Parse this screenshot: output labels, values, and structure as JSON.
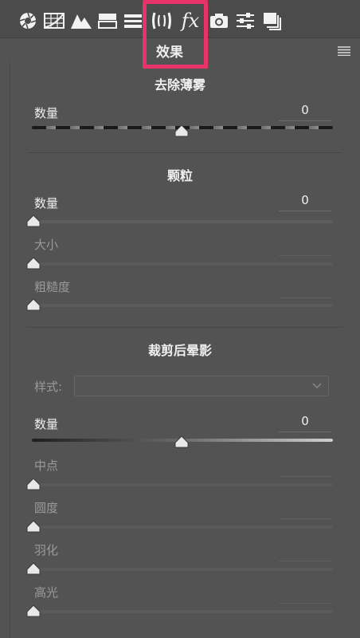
{
  "toolbar": {
    "icons": [
      "aperture-icon",
      "grid-curve-icon",
      "mountains-icon",
      "split-toning-icon",
      "lens-icon",
      "fx-icon",
      "camera-icon",
      "sliders-icon",
      "presets-icon"
    ],
    "active_tab_label": "效果",
    "fx_text": "fx"
  },
  "accent_color": "#e8336a",
  "dehaze": {
    "title": "去除薄雾",
    "amount_label": "数量",
    "amount_value": "0"
  },
  "grain": {
    "title": "颗粒",
    "amount_label": "数量",
    "amount_value": "0",
    "size_label": "大小",
    "roughness_label": "粗糙度"
  },
  "vignette": {
    "title": "裁剪后晕影",
    "style_label": "样式:",
    "amount_label": "数量",
    "amount_value": "0",
    "midpoint_label": "中点",
    "roundness_label": "圆度",
    "feather_label": "羽化",
    "highlights_label": "高光"
  }
}
